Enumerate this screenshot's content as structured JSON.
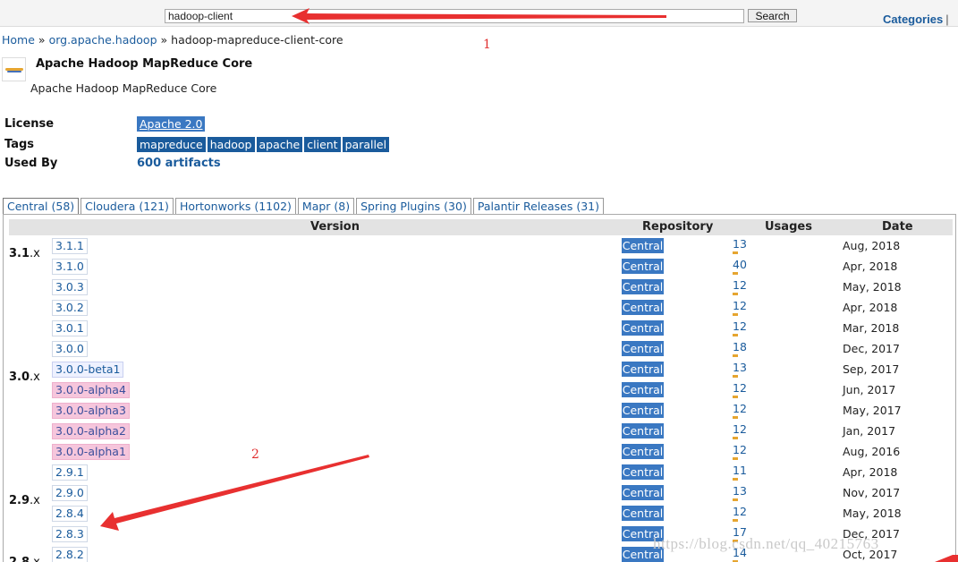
{
  "search": {
    "value": "hadoop-client",
    "button_label": "Search"
  },
  "nav": {
    "categories_label": "Categories",
    "categories_sep": "|"
  },
  "breadcrumb": {
    "home": "Home",
    "sep": "»",
    "group": "org.apache.hadoop",
    "artifact": "hadoop-mapreduce-client-core"
  },
  "artifact": {
    "title": "Apache Hadoop MapReduce Core",
    "description": "Apache Hadoop MapReduce Core"
  },
  "meta": {
    "license_label": "License",
    "license_value": "Apache 2.0",
    "tags_label": "Tags",
    "tags": [
      "mapreduce",
      "hadoop",
      "apache",
      "client",
      "parallel"
    ],
    "usedby_label": "Used By",
    "usedby_value": "600 artifacts"
  },
  "tabs": [
    "Central (58)",
    "Cloudera (121)",
    "Hortonworks (1102)",
    "Mapr (8)",
    "Spring Plugins (30)",
    "Palantir Releases (31)"
  ],
  "table": {
    "headers": {
      "version": "Version",
      "repository": "Repository",
      "usages": "Usages",
      "date": "Date"
    },
    "rows": [
      {
        "group": "3.1",
        "version": "3.1.1",
        "kind": "release",
        "repo": "Central",
        "usages": "13",
        "date": "Aug, 2018"
      },
      {
        "group": "",
        "version": "3.1.0",
        "kind": "release",
        "repo": "Central",
        "usages": "40",
        "date": "Apr, 2018"
      },
      {
        "group": "",
        "version": "3.0.3",
        "kind": "release",
        "repo": "Central",
        "usages": "12",
        "date": "May, 2018"
      },
      {
        "group": "",
        "version": "3.0.2",
        "kind": "release",
        "repo": "Central",
        "usages": "12",
        "date": "Apr, 2018"
      },
      {
        "group": "",
        "version": "3.0.1",
        "kind": "release",
        "repo": "Central",
        "usages": "12",
        "date": "Mar, 2018"
      },
      {
        "group": "",
        "version": "3.0.0",
        "kind": "release",
        "repo": "Central",
        "usages": "18",
        "date": "Dec, 2017"
      },
      {
        "group": "3.0",
        "version": "3.0.0-beta1",
        "kind": "beta",
        "repo": "Central",
        "usages": "13",
        "date": "Sep, 2017"
      },
      {
        "group": "",
        "version": "3.0.0-alpha4",
        "kind": "alpha",
        "repo": "Central",
        "usages": "12",
        "date": "Jun, 2017"
      },
      {
        "group": "",
        "version": "3.0.0-alpha3",
        "kind": "alpha",
        "repo": "Central",
        "usages": "12",
        "date": "May, 2017"
      },
      {
        "group": "",
        "version": "3.0.0-alpha2",
        "kind": "alpha",
        "repo": "Central",
        "usages": "12",
        "date": "Jan, 2017"
      },
      {
        "group": "",
        "version": "3.0.0-alpha1",
        "kind": "alpha",
        "repo": "Central",
        "usages": "12",
        "date": "Aug, 2016"
      },
      {
        "group": "",
        "version": "2.9.1",
        "kind": "release",
        "repo": "Central",
        "usages": "11",
        "date": "Apr, 2018"
      },
      {
        "group": "2.9",
        "version": "2.9.0",
        "kind": "release",
        "repo": "Central",
        "usages": "13",
        "date": "Nov, 2017"
      },
      {
        "group": "",
        "version": "2.8.4",
        "kind": "release",
        "repo": "Central",
        "usages": "12",
        "date": "May, 2018"
      },
      {
        "group": "",
        "version": "2.8.3",
        "kind": "release",
        "repo": "Central",
        "usages": "17",
        "date": "Dec, 2017"
      },
      {
        "group": "2.8",
        "version": "2.8.2",
        "kind": "release",
        "repo": "Central",
        "usages": "14",
        "date": "Oct, 2017"
      }
    ],
    "group_suffix": ".x"
  },
  "annotations": {
    "label_1": "1",
    "label_2": "2",
    "arrow_color": "#e83030"
  },
  "watermark": "https://blog.csdn.net/qq_40215763",
  "colors": {
    "link": "#1a5b9c",
    "badge": "#3a78c2",
    "tag": "#1a5b9c",
    "alpha_bg": "#f6c6dc",
    "usage_bar": "#e6a530"
  }
}
